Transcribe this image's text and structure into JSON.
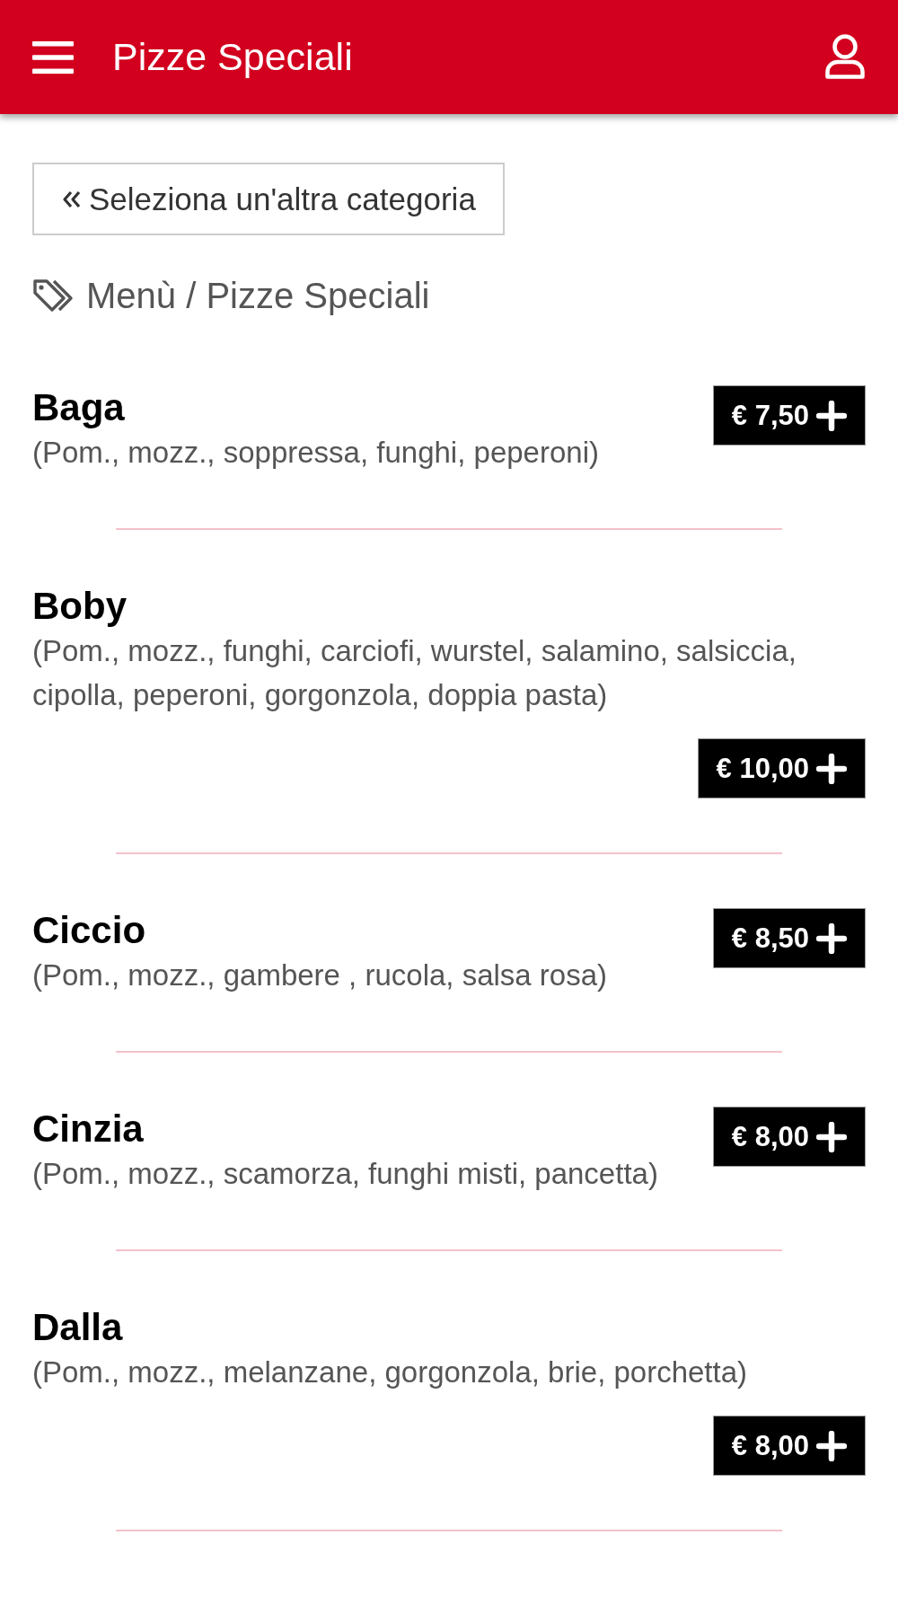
{
  "header": {
    "title": "Pizze Speciali"
  },
  "back_button": {
    "label": "Seleziona un'altra categoria"
  },
  "breadcrumb": {
    "path": "Menù / Pizze Speciali"
  },
  "items": [
    {
      "name": "Baga",
      "description": "(Pom., mozz., soppressa, funghi, peperoni)",
      "price": "€ 7,50"
    },
    {
      "name": "Boby",
      "description": "(Pom., mozz., funghi, carciofi, wurstel, salamino, salsiccia, cipolla, peperoni, gorgonzola, doppia pasta)",
      "price": "€ 10,00"
    },
    {
      "name": "Ciccio",
      "description": "(Pom., mozz., gambere , rucola, salsa rosa)",
      "price": "€ 8,50"
    },
    {
      "name": "Cinzia",
      "description": "(Pom., mozz., scamorza, funghi misti, pancetta)",
      "price": "€ 8,00"
    },
    {
      "name": "Dalla",
      "description": "(Pom., mozz., melanzane, gorgonzola, brie, porchetta)",
      "price": "€ 8,00"
    }
  ]
}
